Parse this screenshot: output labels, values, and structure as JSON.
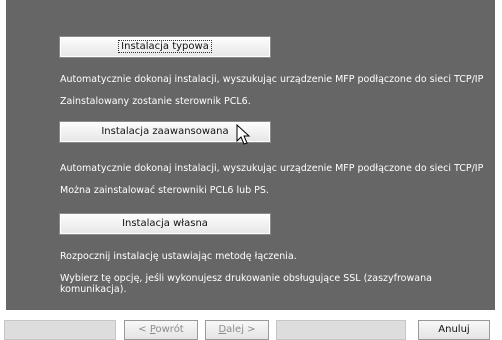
{
  "options": [
    {
      "label": "Instalacja typowa",
      "description_line1": "Automatycznie dokonaj instalacji, wyszukując urządzenie MFP podłączone do sieci TCP/IP",
      "description_line2": "Zainstalowany zostanie sterownik PCL6."
    },
    {
      "label": "Instalacja zaawansowana",
      "description_line1": "Automatycznie dokonaj instalacji, wyszukując urządzenie MFP podłączone do sieci TCP/IP",
      "description_line2": "Można zainstalować sterowniki PCL6 lub PS."
    },
    {
      "label": "Instalacja własna",
      "description_line1": "Rozpocznij  instalację ustawiając metodę łączenia.",
      "description_line2": "Wybierz tę opcję, jeśli wykonujesz drukowanie obsługujące SSL (zaszyfrowana komunikacja)."
    }
  ],
  "nav": {
    "back_prefix": "< ",
    "back_mnemonic": "P",
    "back_rest": "owrót",
    "next_mnemonic": "D",
    "next_rest": "alej >",
    "cancel": "Anuluj"
  },
  "colors": {
    "panel_bg": "#666666",
    "text_on_panel": "#ffffff"
  },
  "icons": {
    "cursor": "mouse-pointer-icon"
  }
}
